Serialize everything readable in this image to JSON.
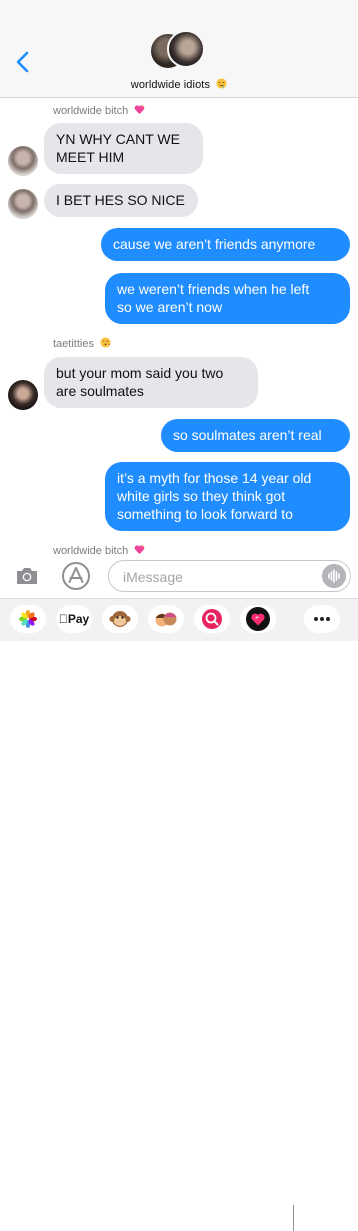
{
  "header": {
    "group_title": "worldwide idiots",
    "title_emoji": "drooling-face-emoji"
  },
  "thread": {
    "groups": [
      {
        "sender": "worldwide bitch",
        "sender_emoji": "sparkling-heart-emoji",
        "messages": [
          {
            "lines": [
              "YN WHY CANT WE",
              "MEET HIM"
            ]
          },
          {
            "lines": [
              "I BET HES SO NICE"
            ]
          }
        ]
      },
      {
        "direction": "outgoing",
        "messages": [
          {
            "lines": [
              "cause we aren’t friends anymore"
            ]
          },
          {
            "lines": [
              "we weren’t friends when he left",
              "so we aren’t now"
            ]
          }
        ]
      },
      {
        "sender": "taetitties",
        "sender_emoji": "kissing-face-emoji",
        "messages": [
          {
            "lines": [
              "but your mom said you two",
              "are soulmates"
            ]
          }
        ]
      },
      {
        "direction": "outgoing",
        "messages": [
          {
            "lines": [
              "so soulmates aren’t real"
            ]
          },
          {
            "lines": [
              "it’s a myth for those 14 year old",
              "white girls so they think got",
              "something to look forward to"
            ]
          }
        ]
      },
      {
        "sender": "worldwide bitch",
        "sender_emoji": "sparkling-heart-emoji"
      }
    ]
  },
  "input": {
    "placeholder": "iMessage"
  },
  "app_drawer": {
    "apps": [
      {
        "name": "photos-app-icon"
      },
      {
        "name": "apple-pay-app",
        "label": "Pay"
      },
      {
        "name": "animoji-monkey-icon"
      },
      {
        "name": "memoji-icon"
      },
      {
        "name": "images-search-icon"
      },
      {
        "name": "digital-touch-icon"
      },
      {
        "name": "more-apps-icon"
      }
    ]
  },
  "colors": {
    "accent": "#1f8cff",
    "incoming_bubble": "#e5e5ea",
    "outgoing_bubble": "#1f8cff",
    "header_bg": "#f7f7f8"
  }
}
